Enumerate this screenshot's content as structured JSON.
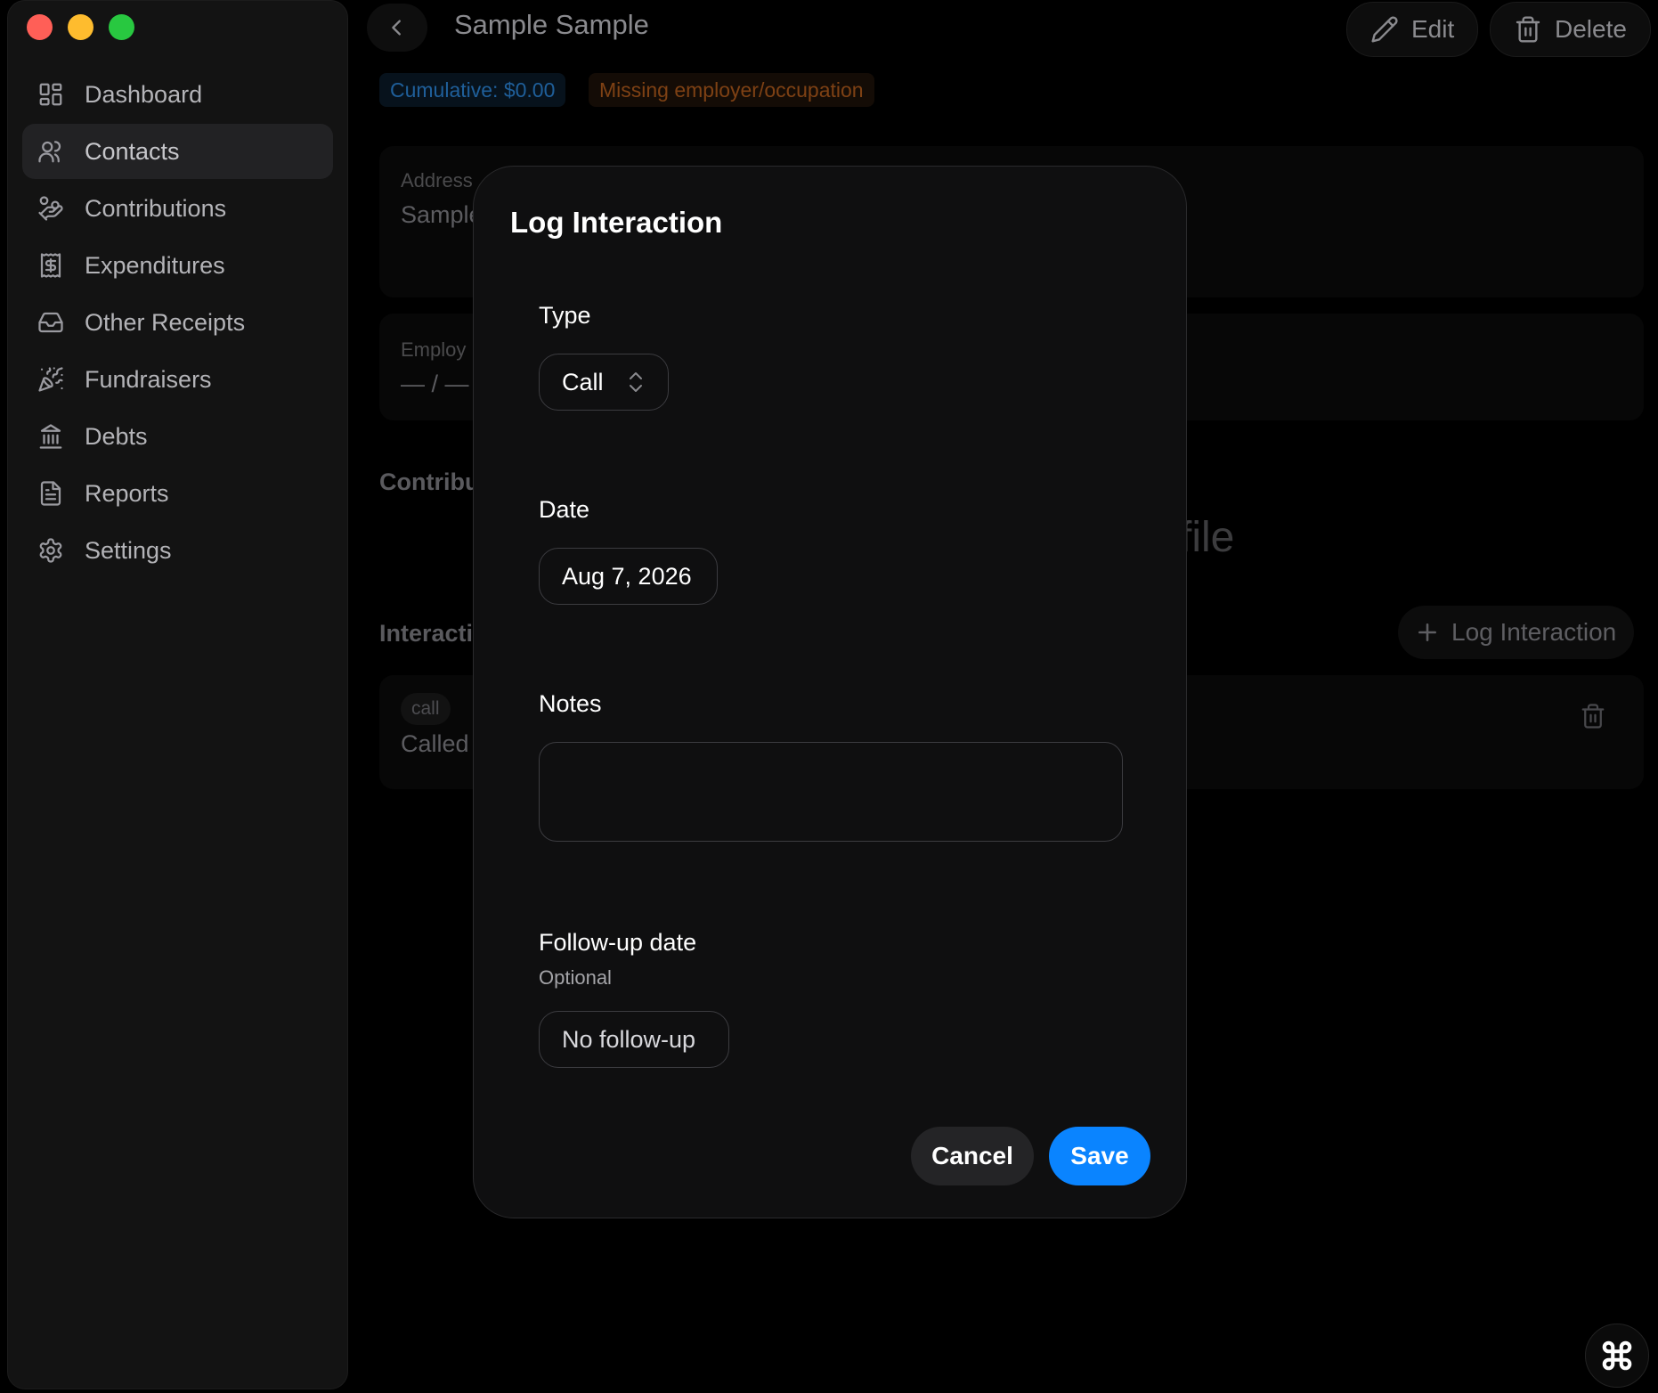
{
  "window": {
    "traffic_lights": [
      "close",
      "minimize",
      "zoom"
    ]
  },
  "sidebar": {
    "items": [
      {
        "label": "Dashboard",
        "icon": "dashboard-icon"
      },
      {
        "label": "Contacts",
        "icon": "users-icon",
        "active": true
      },
      {
        "label": "Contributions",
        "icon": "hand-coins-icon"
      },
      {
        "label": "Expenditures",
        "icon": "receipt-dollar-icon"
      },
      {
        "label": "Other Receipts",
        "icon": "inbox-icon"
      },
      {
        "label": "Fundraisers",
        "icon": "party-popper-icon"
      },
      {
        "label": "Debts",
        "icon": "bank-icon"
      },
      {
        "label": "Reports",
        "icon": "file-text-icon"
      },
      {
        "label": "Settings",
        "icon": "gear-icon"
      }
    ]
  },
  "header": {
    "title": "Sample Sample",
    "edit_label": "Edit",
    "delete_label": "Delete"
  },
  "badges": {
    "cumulative": "Cumulative: $0.00",
    "warning": "Missing employer/occupation"
  },
  "background": {
    "address_label": "Address",
    "address_value": "Sample",
    "employer_label": "Employ",
    "employer_value": "— / —",
    "contributions_title": "Contribu",
    "ghost_text": "file",
    "interactions_title": "Interacti",
    "log_interaction_label": "Log Interaction",
    "interaction_type": "call",
    "interaction_note": "Called"
  },
  "modal": {
    "title": "Log Interaction",
    "type_label": "Type",
    "type_value": "Call",
    "date_label": "Date",
    "date_value": "Aug 7, 2026",
    "notes_label": "Notes",
    "notes_value": "",
    "followup_label": "Follow-up date",
    "followup_hint": "Optional",
    "followup_value": "No follow-up",
    "cancel_label": "Cancel",
    "save_label": "Save"
  },
  "colors": {
    "accent": "#0a84ff",
    "close": "#ff5f57",
    "minimize": "#febc2e",
    "zoom": "#28c840"
  }
}
